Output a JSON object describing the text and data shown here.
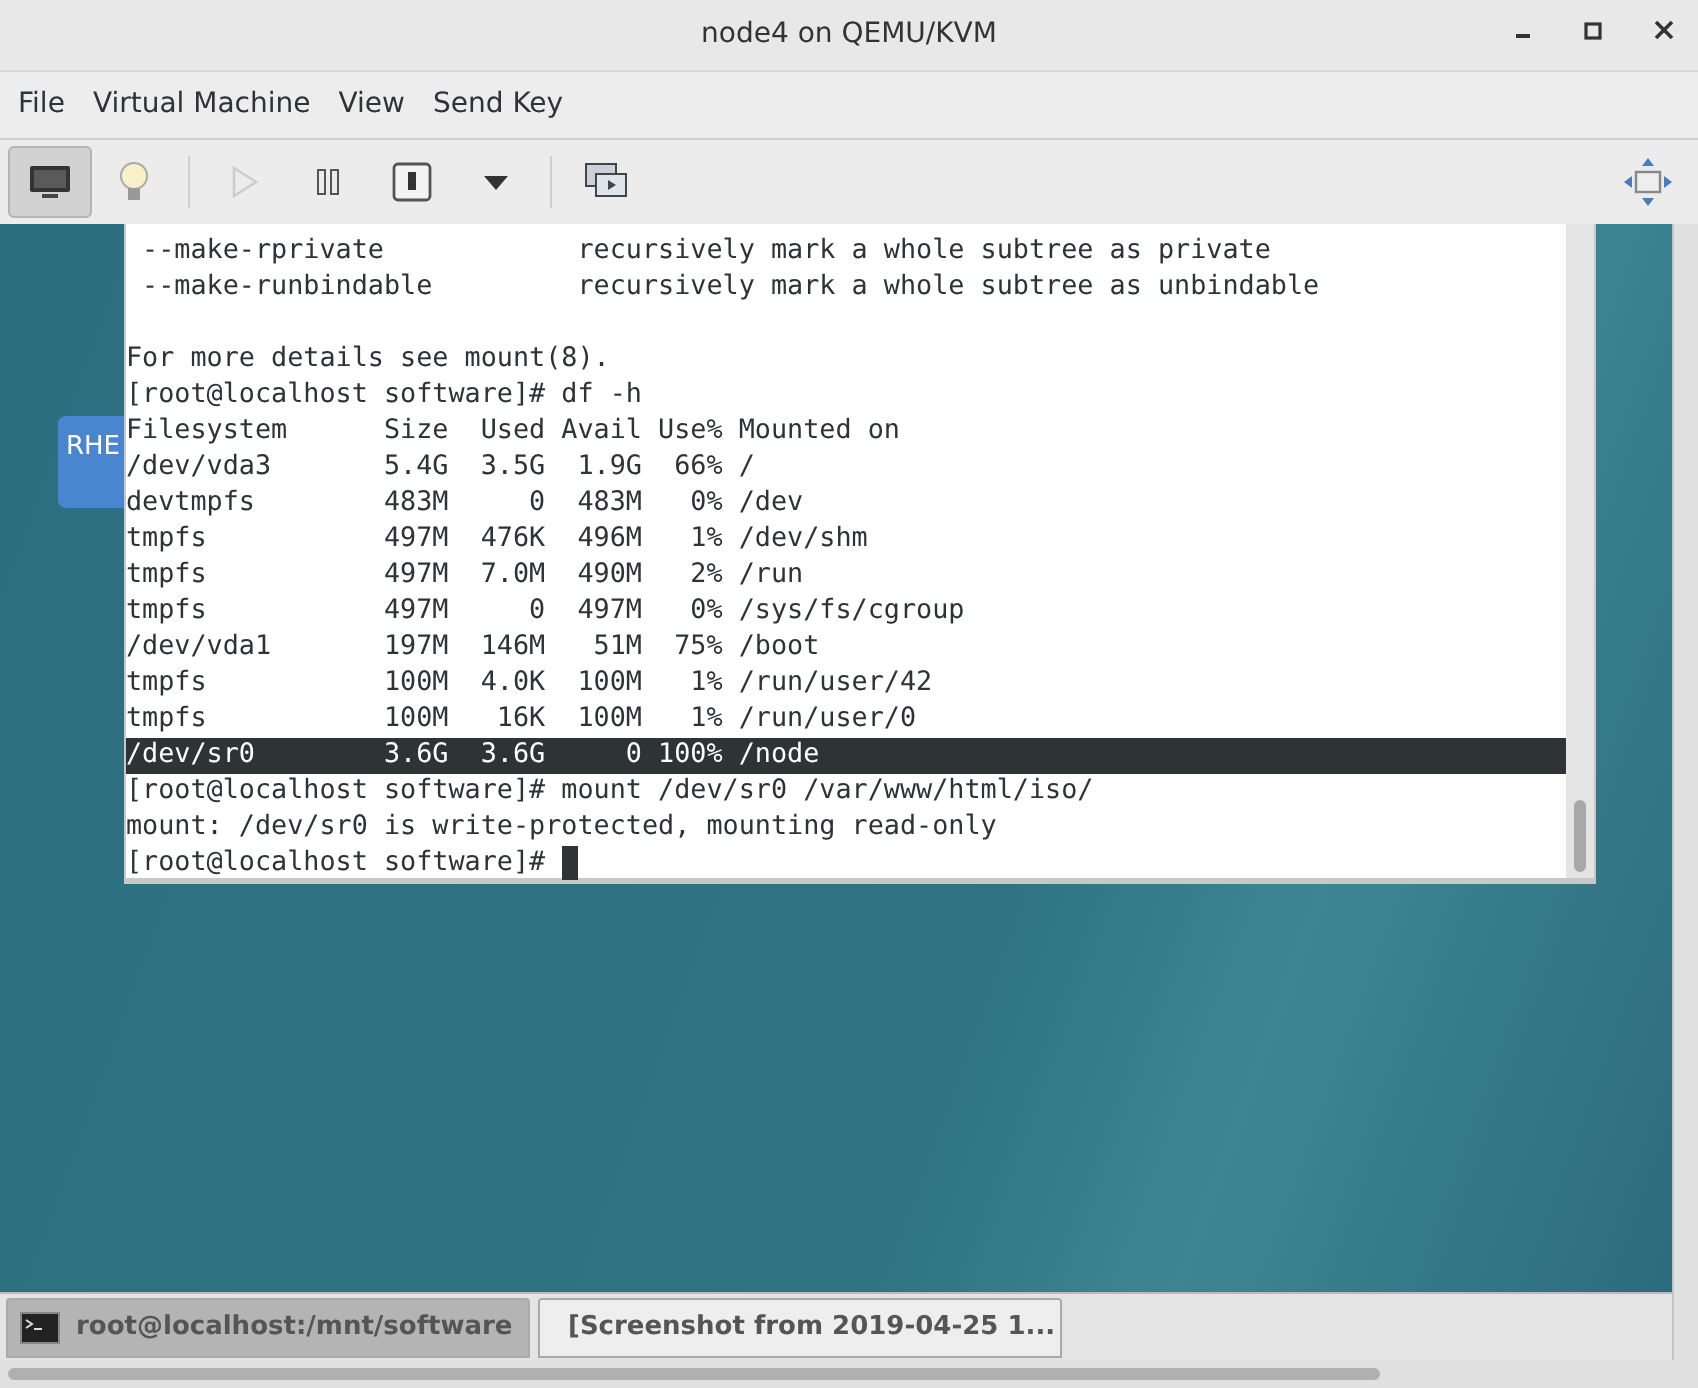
{
  "window": {
    "title": "node4 on QEMU/KVM"
  },
  "menu": [
    "File",
    "Virtual Machine",
    "View",
    "Send Key"
  ],
  "toolbar": [
    {
      "kind": "console",
      "selected": true,
      "disabled": false
    },
    {
      "kind": "details",
      "selected": false,
      "disabled": false
    },
    {
      "kind": "run",
      "selected": false,
      "disabled": true
    },
    {
      "kind": "pause",
      "selected": false,
      "disabled": false
    },
    {
      "kind": "shutdown",
      "selected": false,
      "disabled": false
    },
    {
      "kind": "dropdown",
      "selected": false,
      "disabled": false
    },
    {
      "kind": "screens",
      "selected": false,
      "disabled": false
    },
    {
      "kind": "resize",
      "selected": false,
      "disabled": false
    }
  ],
  "desktop": {
    "icon_label": "RHE"
  },
  "terminal": {
    "lines": [
      {
        "text": " --make-rprivate            recursively mark a whole subtree as private",
        "selected": false,
        "cursor": false
      },
      {
        "text": " --make-runbindable         recursively mark a whole subtree as unbindable",
        "selected": false,
        "cursor": false
      },
      {
        "selected": false
      },
      {
        "text": "For more details see mount(8).",
        "selected": false,
        "cursor": false
      },
      {
        "text": "[root@localhost software]# df -h",
        "selected": false,
        "cursor": false
      },
      {
        "text": "Filesystem      Size  Used Avail Use% Mounted on",
        "selected": false,
        "cursor": false
      },
      {
        "text": "/dev/vda3       5.4G  3.5G  1.9G  66% /",
        "selected": false,
        "cursor": false
      },
      {
        "text": "devtmpfs        483M     0  483M   0% /dev",
        "selected": false,
        "cursor": false
      },
      {
        "text": "tmpfs           497M  476K  496M   1% /dev/shm",
        "selected": false,
        "cursor": false
      },
      {
        "text": "tmpfs           497M  7.0M  490M   2% /run",
        "selected": false,
        "cursor": false
      },
      {
        "text": "tmpfs           497M     0  497M   0% /sys/fs/cgroup",
        "selected": false,
        "cursor": false
      },
      {
        "text": "/dev/vda1       197M  146M   51M  75% /boot",
        "selected": false,
        "cursor": false
      },
      {
        "text": "tmpfs           100M  4.0K  100M   1% /run/user/42",
        "selected": false,
        "cursor": false
      },
      {
        "text": "tmpfs           100M   16K  100M   1% /run/user/0",
        "selected": false,
        "cursor": false
      },
      {
        "text": "/dev/sr0        3.6G  3.6G     0 100% /node",
        "selected": true,
        "cursor": false
      },
      {
        "text": "[root@localhost software]# mount /dev/sr0 /var/www/html/iso/",
        "selected": false,
        "cursor": false
      },
      {
        "text": "mount: /dev/sr0 is write-protected, mounting read-only",
        "selected": false,
        "cursor": false
      },
      {
        "text": "[root@localhost software]# ",
        "selected": false,
        "cursor": true
      }
    ]
  },
  "taskbar": [
    {
      "kind": "terminal",
      "label": "root@localhost:/mnt/software",
      "selected": true
    },
    {
      "kind": "viewer",
      "label": "[Screenshot from 2019-04-25 1...",
      "selected": false
    }
  ]
}
